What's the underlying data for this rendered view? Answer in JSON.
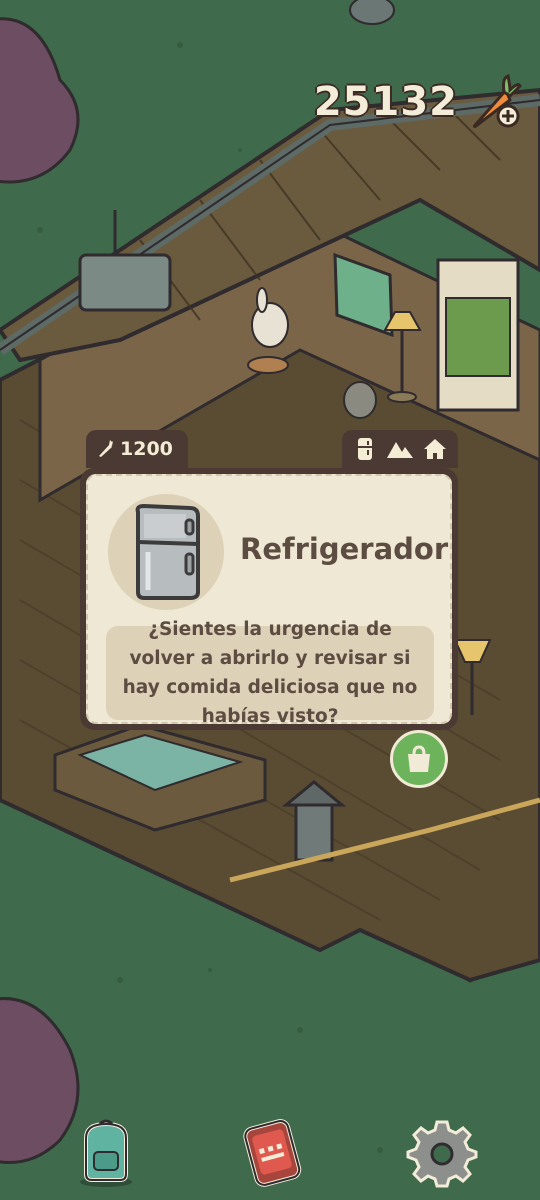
{
  "currency": {
    "amount": "25132",
    "icon": "carrot-plus-icon"
  },
  "item_card": {
    "price": "1200",
    "price_icon": "carrot-icon",
    "categories": [
      "fridge-icon",
      "mountain-icon",
      "house-icon"
    ],
    "name": "Refrigerador",
    "description": "¿Sientes la urgencia de volver a abrirlo y revisar si hay comida deliciosa que no habías visto?",
    "buy_icon": "shopping-bag-icon"
  },
  "bottom_bar": {
    "items": [
      "backpack-icon",
      "phone-icon",
      "gear-icon"
    ]
  },
  "colors": {
    "grass": "#3f6a4b",
    "card_bg": "#efe8d4",
    "card_border": "#4b3a33",
    "text": "#5c4c42",
    "buy_green": "#6db35c"
  }
}
